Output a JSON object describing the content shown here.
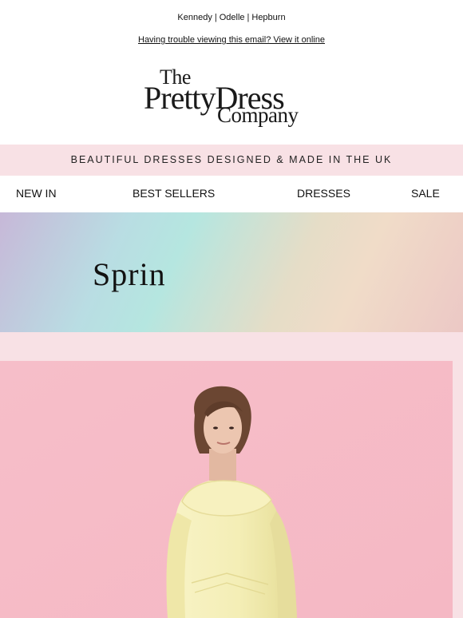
{
  "brand_links": [
    "Kennedy",
    "Odelle",
    "Hepburn"
  ],
  "separator": "|",
  "view_online_text": "Having trouble viewing this email? View it online",
  "logo": {
    "line1": "The",
    "line2": "PrettyDress",
    "line3": "Company"
  },
  "tagline": "BEAUTIFUL DRESSES DESIGNED & MADE IN THE UK",
  "nav": {
    "new_in": "NEW IN",
    "best_sellers": "BEST SELLERS",
    "dresses": "DRESSES",
    "sale": "SALE"
  },
  "hero": {
    "word": "Sprin"
  },
  "colors": {
    "tagline_bg": "#f8e1e5",
    "photo_bg": "#f6bec9",
    "dress": "#f6f0b9",
    "hair": "#6b4632",
    "skin": "#e9c3ad"
  }
}
